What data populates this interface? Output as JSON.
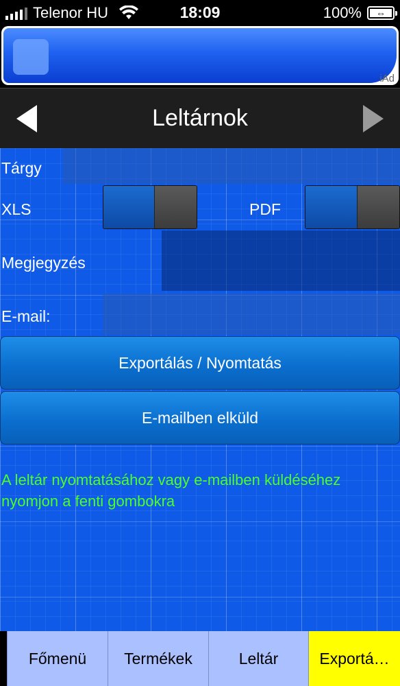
{
  "status_bar": {
    "carrier": "Telenor HU",
    "time": "18:09",
    "battery": "100%"
  },
  "ad": {
    "label": "iAd"
  },
  "nav": {
    "title": "Leltárnok"
  },
  "form": {
    "subject_label": "Tárgy",
    "xls_label": "XLS",
    "pdf_label": "PDF",
    "note_label": "Megjegyzés",
    "email_label": "E-mail:"
  },
  "buttons": {
    "export_print": "Exportálás / Nyomtatás",
    "send_email": "E-mailben elküld"
  },
  "hint": "A leltár nyomtatásához vagy e-mailben küldéséhez nyomjon a fenti gombokra",
  "tabs": [
    {
      "label": "Főmenü",
      "active": false
    },
    {
      "label": "Termékek",
      "active": false
    },
    {
      "label": "Leltár",
      "active": false
    },
    {
      "label": "Exportá…",
      "active": true
    }
  ]
}
